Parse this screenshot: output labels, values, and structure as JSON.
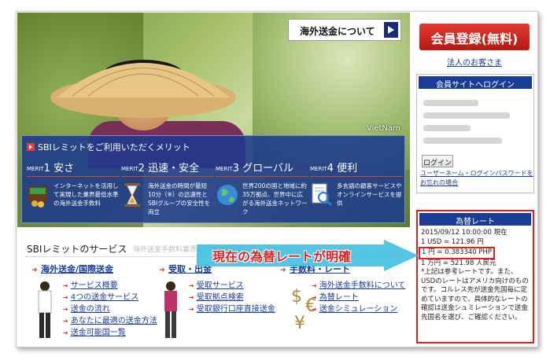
{
  "hero": {
    "kaigai_button": "海外送金について",
    "location_label": "VietNam",
    "merit_title": "SBIレミットをご利用いただくメリット",
    "merits": [
      {
        "tag": "MERIT",
        "num": "1",
        "title": "安さ",
        "text": "インターネットを活用して実現した業界最低水準の海外送金手数料"
      },
      {
        "tag": "MERIT",
        "num": "2",
        "title": "迅速・安全",
        "text": "海外送金の時間が最短10分（※）の迅速性とSBIグループの安全性を両立"
      },
      {
        "tag": "MERIT",
        "num": "3",
        "title": "グローバル",
        "text": "世界200の国と地域に約35万拠点、世界中に広がる海外送金ネットワーク"
      },
      {
        "tag": "MERIT",
        "num": "4",
        "title": "便利",
        "text": "多言語の顧客サービスやオンラインサービスを提供"
      }
    ]
  },
  "services": {
    "title": "SBIレミットのサービス",
    "subtitle": "海外送金手数料業界最低水準SBIレミットのサービス",
    "columns": [
      {
        "head": "海外送金/国際送金",
        "links": [
          "サービス概要",
          "4つの送金サービス",
          "送金の流れ",
          "あなたに最適の送金方法",
          "送金可能国一覧"
        ]
      },
      {
        "head": "受取・出金",
        "links": [
          "受取サービス",
          "受取拠点検索",
          "受取銀行口座直接送金"
        ]
      },
      {
        "head": "手数料・レート",
        "links": [
          "海外送金手数料について",
          "為替レート",
          "送金シミュレーション"
        ]
      }
    ]
  },
  "sidebar": {
    "register_button": "会員登録(無料)",
    "corporate_link": "法人のお客さま",
    "login_header": "会員サイトへログイン",
    "login_button": "ログイン",
    "forgot_link": "ユーザーネーム・ログインパスワードをお忘れの場合"
  },
  "rate": {
    "header": "為替レート",
    "lines": [
      "2015/09/12 10:00:00 現在",
      "1 USD = 121.96 円",
      "1 円 = 0.383340 PHP",
      "1 万円 = 521.98 人民元",
      "*上記は参考レートです。また、USDのレートはアメリカ向けのものです。コルレス先が送金先国毎に定めていますので、具体的なレートの確認は送金シュミレーションで送金先国名を選び、ご確認ください。"
    ]
  },
  "callout": {
    "text": "現在の為替レートが明確"
  },
  "colors": {
    "brand_blue": "#1a3c96",
    "accent_red": "#e02020",
    "callout_cyan": "#3fc0e0"
  }
}
